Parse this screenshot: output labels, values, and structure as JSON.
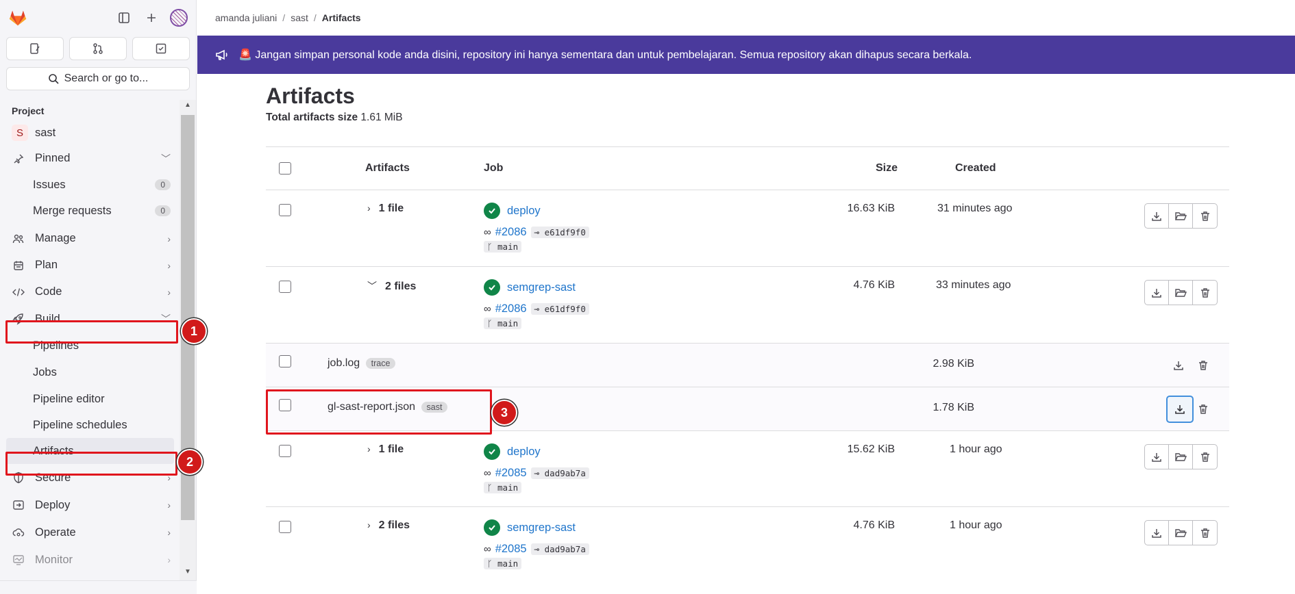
{
  "sidebar": {
    "search_placeholder": "Search or go to...",
    "section_title": "Project",
    "project": {
      "initial": "S",
      "name": "sast"
    },
    "pinned": {
      "label": "Pinned",
      "items": [
        {
          "label": "Issues",
          "count": "0"
        },
        {
          "label": "Merge requests",
          "count": "0"
        }
      ]
    },
    "items": {
      "manage": "Manage",
      "plan": "Plan",
      "code": "Code",
      "build": "Build",
      "secure": "Secure",
      "deploy": "Deploy",
      "operate": "Operate",
      "monitor": "Monitor"
    },
    "build_sub": [
      "Pipelines",
      "Jobs",
      "Pipeline editor",
      "Pipeline schedules",
      "Artifacts"
    ]
  },
  "breadcrumb": [
    "amanda juliani",
    "sast",
    "Artifacts"
  ],
  "banner": {
    "text": "🚨 Jangan simpan personal kode anda disini, repository ini hanya sementara dan untuk pembelajaran. Semua repository akan dihapus secara berkala."
  },
  "page": {
    "title": "Artifacts",
    "total_label": "Total artifacts size",
    "total_value": "1.61 MiB"
  },
  "table": {
    "headers": {
      "artifacts": "Artifacts",
      "job": "Job",
      "size": "Size",
      "created": "Created"
    },
    "rows": [
      {
        "files": "1 file",
        "job": "deploy",
        "pipeline": "#2086",
        "commit": "e61df9f0",
        "branch": "main",
        "size": "16.63 KiB",
        "created": "31 minutes ago"
      },
      {
        "files": "2 files",
        "job": "semgrep-sast",
        "pipeline": "#2086",
        "commit": "e61df9f0",
        "branch": "main",
        "size": "4.76 KiB",
        "created": "33 minutes ago",
        "children": [
          {
            "name": "job.log",
            "tag": "trace",
            "size": "2.98 KiB"
          },
          {
            "name": "gl-sast-report.json",
            "tag": "sast",
            "size": "1.78 KiB"
          }
        ]
      },
      {
        "files": "1 file",
        "job": "deploy",
        "pipeline": "#2085",
        "commit": "dad9ab7a",
        "branch": "main",
        "size": "15.62 KiB",
        "created": "1 hour ago"
      },
      {
        "files": "2 files",
        "job": "semgrep-sast",
        "pipeline": "#2085",
        "commit": "dad9ab7a",
        "branch": "main",
        "size": "4.76 KiB",
        "created": "1 hour ago"
      }
    ]
  },
  "annotations": {
    "step1": "1",
    "step2": "2",
    "step3": "3"
  },
  "colors": {
    "banner": "#4a3a9c",
    "link": "#1f75cb",
    "success": "#108548",
    "annotation": "#e0151d"
  }
}
